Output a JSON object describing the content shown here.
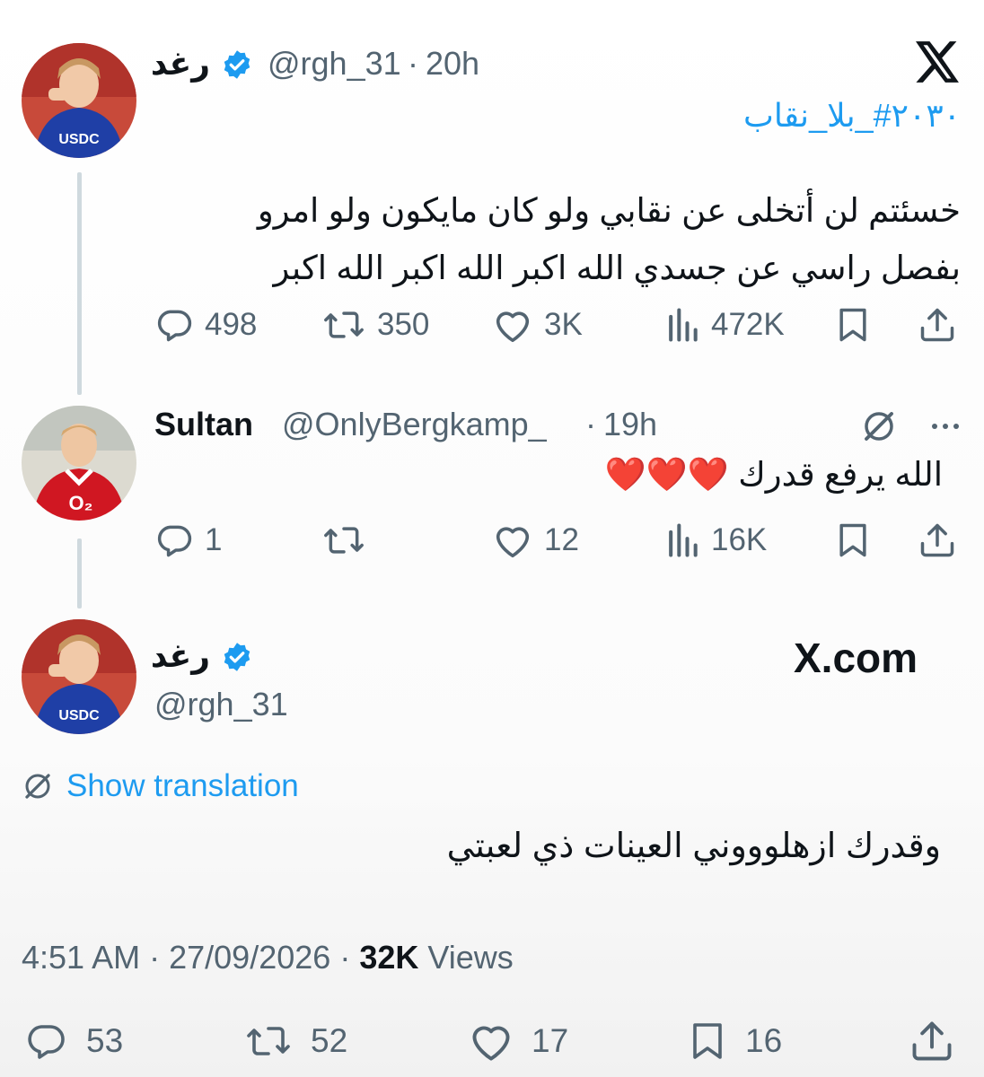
{
  "tweet1": {
    "display_name": "رغد",
    "handle": "@rgh_31",
    "separator": "·",
    "time": "20h",
    "hashtag": "#۲۰۳۰_بلا_نقاب",
    "text_line1": "خسئتم لن أتخلى عن نقابي ولو كان مايكون ولو امرو",
    "text_line2": "بفصل راسي عن جسدي الله اكبر الله اكبر الله اكبر",
    "replies": "498",
    "reposts": "350",
    "likes": "3K",
    "views": "472K"
  },
  "reply": {
    "display_name": "Sultan",
    "handle": "@OnlyBergkamp_",
    "separator": "·",
    "time": "19h",
    "text": "الله يرفع قدرك",
    "hearts": "❤️❤️❤️",
    "replies": "1",
    "reposts": "",
    "likes": "12",
    "views": "16K"
  },
  "main": {
    "display_name": "رغد",
    "handle": "@rgh_31",
    "brand": "X.com",
    "translate_label": "Show translation",
    "text": "وقدرك ازهلوووني العينات ذي لعبتي",
    "time": "4:51 AM",
    "date": "27/09/2026",
    "views_count": "32K",
    "views_label": "Views",
    "replies": "53",
    "reposts": "52",
    "likes": "17",
    "bookmarks": "16"
  },
  "colors": {
    "accent": "#1d9bf0",
    "text": "#0f1419",
    "muted": "#536471",
    "heart": "#e0182d"
  },
  "icons": [
    "x-logo-icon",
    "verified-badge-icon",
    "reply-icon",
    "repost-icon",
    "like-icon",
    "views-icon",
    "bookmark-icon",
    "share-icon",
    "grok-icon",
    "more-icon",
    "translate-icon"
  ]
}
